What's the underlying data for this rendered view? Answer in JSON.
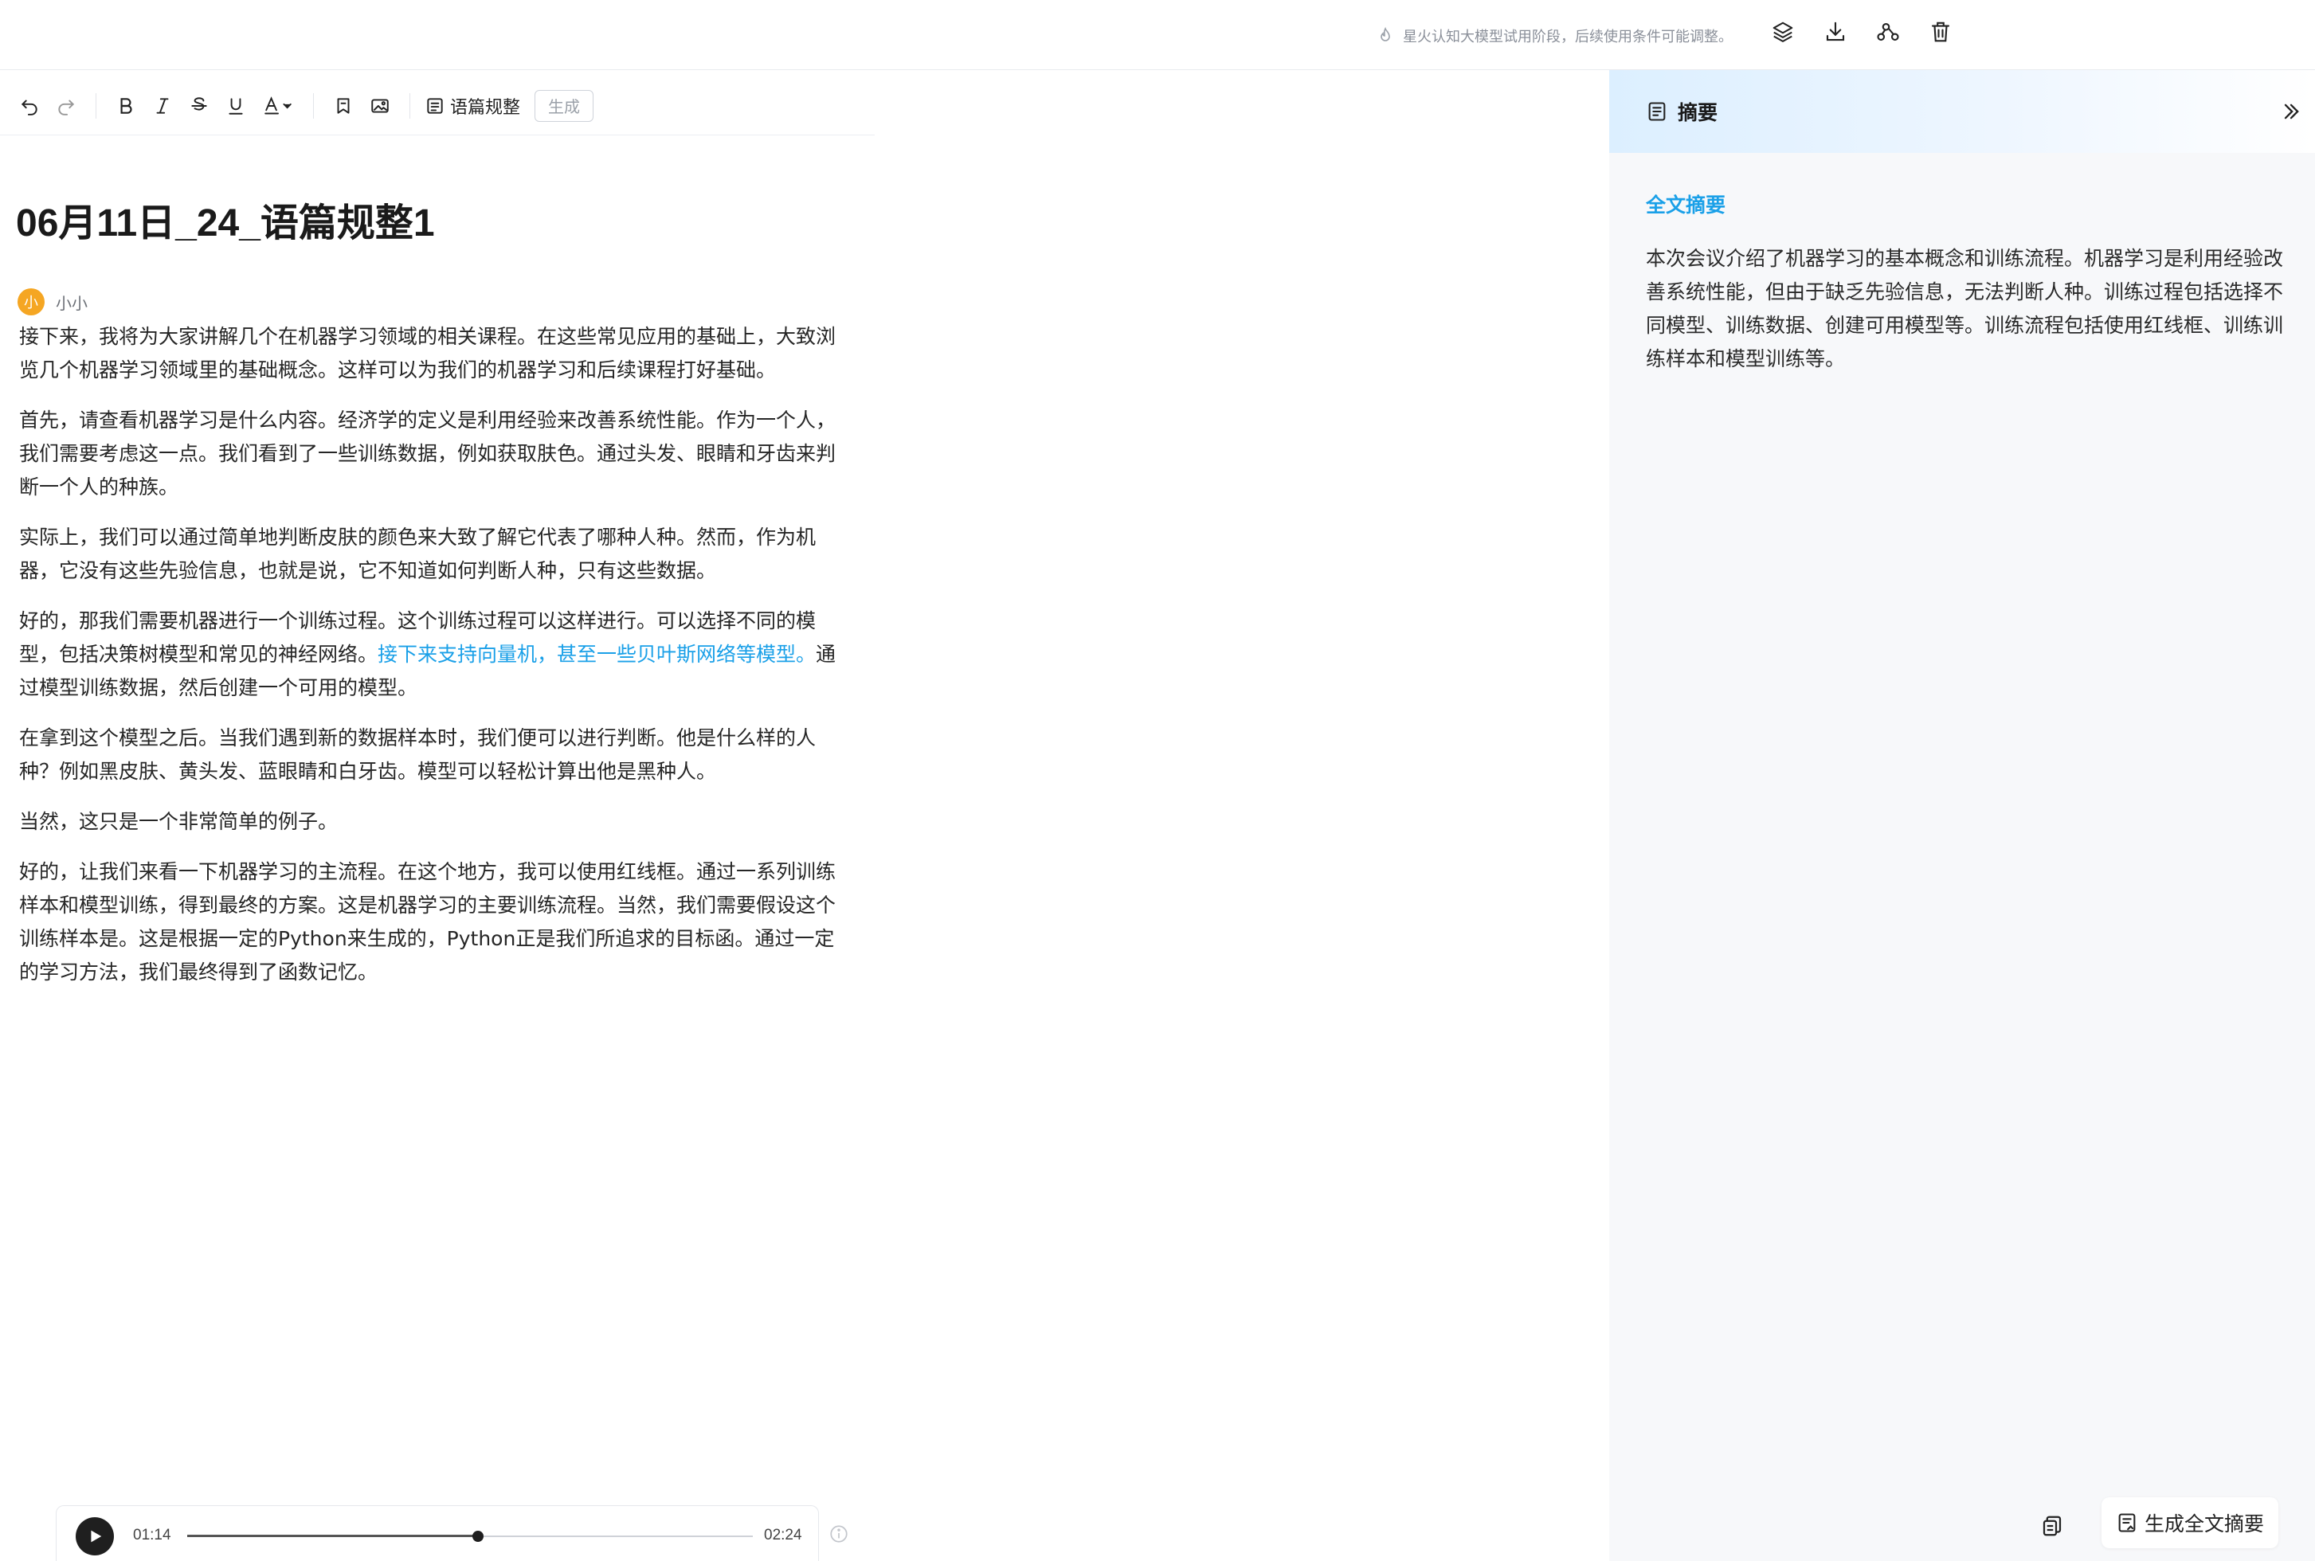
{
  "topbar": {
    "notice": "星火认知大模型试用阶段，后续使用条件可能调整。",
    "actions": [
      "layers-icon",
      "download-icon",
      "share-icon",
      "delete-icon"
    ]
  },
  "toolbar": {
    "items": [
      "undo-icon",
      "redo-icon",
      "bold-icon",
      "italic-icon",
      "strikethrough-icon",
      "underline-icon",
      "font-color-icon",
      "bookmark-icon",
      "image-icon"
    ],
    "discourse_label": "语篇规整",
    "generate_label": "生成"
  },
  "document": {
    "title": "06月11日_24_语篇规整1",
    "speaker": {
      "avatar_text": "小",
      "name": "小小"
    },
    "paragraphs": [
      "接下来，我将为大家讲解几个在机器学习领域的相关课程。在这些常见应用的基础上，大致浏览几个机器学习领域里的基础概念。这样可以为我们的机器学习和后续课程打好基础。",
      "首先，请查看机器学习是什么内容。经济学的定义是利用经验来改善系统性能。作为一个人，我们需要考虑这一点。我们看到了一些训练数据，例如获取肤色。通过头发、眼睛和牙齿来判断一个人的种族。",
      "实际上，我们可以通过简单地判断皮肤的颜色来大致了解它代表了哪种人种。然而，作为机器，它没有这些先验信息，也就是说，它不知道如何判断人种，只有这些数据。",
      {
        "before": "好的，那我们需要机器进行一个训练过程。这个训练过程可以这样进行。可以选择不同的模型，包括决策树模型和常见的神经网络。",
        "highlight": "接下来支持向量机，甚至一些贝叶斯网络等模型。",
        "after": "通过模型训练数据，然后创建一个可用的模型。"
      },
      "在拿到这个模型之后。当我们遇到新的数据样本时，我们便可以进行判断。他是什么样的人种？例如黑皮肤、黄头发、蓝眼睛和白牙齿。模型可以轻松计算出他是黑种人。",
      "当然，这只是一个非常简单的例子。",
      "好的，让我们来看一下机器学习的主流程。在这个地方，我可以使用红线框。通过一系列训练样本和模型训练，得到最终的方案。这是机器学习的主要训练流程。当然，我们需要假设这个训练样本是。这是根据一定的Python来生成的，Python正是我们所追求的目标函。通过一定的学习方法，我们最终得到了函数记忆。"
    ]
  },
  "summary_panel": {
    "title": "摘要",
    "section_title": "全文摘要",
    "text": "本次会议介绍了机器学习的基本概念和训练流程。机器学习是利用经验改善系统性能，但由于缺乏先验信息，无法判断人种。训练过程包括选择不同模型、训练数据、创建可用模型等。训练流程包括使用红线框、训练训练样本和模型训练等。",
    "generate_button": "生成全文摘要"
  },
  "player": {
    "current_time": "01:14",
    "total_time": "02:24",
    "progress": 0.5139
  },
  "colors": {
    "accent": "#1aa0e8",
    "avatar": "#f5a623"
  }
}
